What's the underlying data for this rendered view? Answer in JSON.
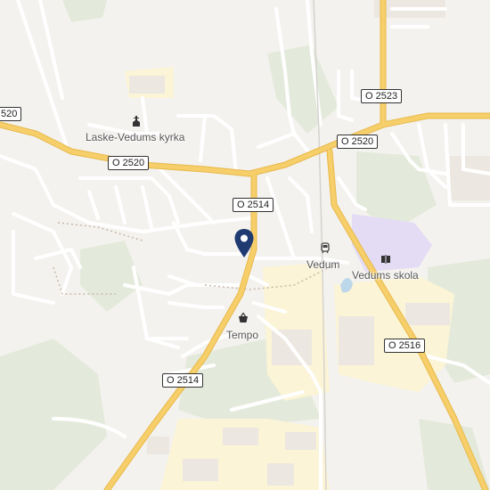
{
  "map": {
    "colors": {
      "background": "#f4f2ee",
      "major_road": "#f6cf6b",
      "major_road_casing": "#e8b849",
      "minor_road": "#ffffff",
      "green": "#e4eadb",
      "industrial": "#fbf4d6",
      "school_area": "#e4dcf4",
      "water": "#bcd6ea",
      "building": "#ece7e0",
      "pin": "#1f3b72"
    },
    "road_shields": {
      "o2520_left_edge": "520",
      "o2520_west": "O 2520",
      "o2520_east": "O 2520",
      "o2523": "O 2523",
      "o2514_north": "O 2514",
      "o2514_south": "O 2514",
      "o2516": "O 2516"
    },
    "pois": {
      "church": {
        "label": "Laske-Vedums kyrka",
        "icon": "church-icon"
      },
      "station": {
        "label": "Vedum",
        "icon": "train-icon"
      },
      "school": {
        "label": "Vedums skola",
        "icon": "school-icon"
      },
      "shop": {
        "label": "Tempo",
        "icon": "shopping-basket-icon"
      }
    },
    "marker": {
      "icon": "location-pin-icon"
    }
  }
}
